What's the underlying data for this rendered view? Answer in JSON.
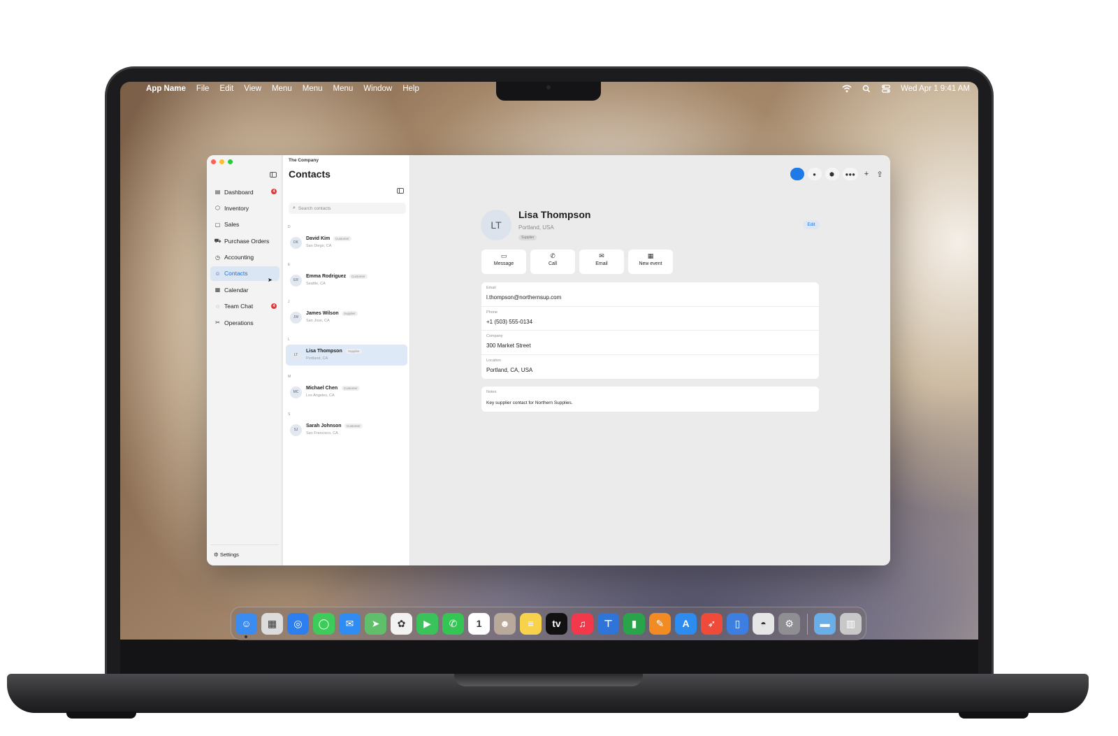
{
  "menubar": {
    "app_name": "App Name",
    "menus": [
      "File",
      "Edit",
      "View",
      "Menu",
      "Menu",
      "Menu",
      "Window",
      "Help"
    ],
    "datetime": "Wed Apr 1  9:41 AM"
  },
  "sidebar": {
    "items": [
      {
        "label": "Dashboard",
        "icon": "dashboard-icon",
        "glyph": "▤",
        "badge": "4"
      },
      {
        "label": "Inventory",
        "icon": "box-icon",
        "glyph": "⬡"
      },
      {
        "label": "Sales",
        "icon": "bag-icon",
        "glyph": "▢"
      },
      {
        "label": "Purchase Orders",
        "icon": "cart-icon",
        "glyph": "⛟"
      },
      {
        "label": "Accounting",
        "icon": "clock-icon",
        "glyph": "◷"
      },
      {
        "label": "Contacts",
        "icon": "people-icon",
        "glyph": "☺",
        "active": true
      },
      {
        "label": "Calendar",
        "icon": "calendar-icon",
        "glyph": "▦"
      },
      {
        "label": "Team Chat",
        "icon": "chat-icon",
        "glyph": "◌",
        "badge": "4"
      },
      {
        "label": "Operations",
        "icon": "tools-icon",
        "glyph": "✂"
      }
    ],
    "settings_label": "Settings"
  },
  "list": {
    "company": "The Company",
    "title": "Contacts",
    "search_placeholder": "Search contacts",
    "sections": [
      {
        "letter": "D",
        "contact": {
          "initials": "DK",
          "name": "David Kim",
          "tag": "Customer",
          "location": "San Diego, CA"
        }
      },
      {
        "letter": "E",
        "contact": {
          "initials": "ER",
          "name": "Emma Rodriguez",
          "tag": "Customer",
          "location": "Seattle, CA"
        }
      },
      {
        "letter": "J",
        "contact": {
          "initials": "JW",
          "name": "James Wilson",
          "tag": "Supplier",
          "location": "San Jose, CA"
        }
      },
      {
        "letter": "L",
        "contact": {
          "initials": "LT",
          "name": "Lisa Thompson",
          "tag": "Supplier",
          "location": "Portland, CA",
          "active": true
        }
      },
      {
        "letter": "M",
        "contact": {
          "initials": "MC",
          "name": "Michael Chen",
          "tag": "Customer",
          "location": "Los Angeles, CA"
        }
      },
      {
        "letter": "S",
        "contact": {
          "initials": "SJ",
          "name": "Sarah Johnson",
          "tag": "Customer",
          "location": "San Francisco, CA"
        }
      }
    ]
  },
  "detail": {
    "initials": "LT",
    "name": "Lisa Thompson",
    "location": "Portland, USA",
    "tag": "Supplier",
    "edit_label": "Edit",
    "actions": [
      {
        "label": "Message",
        "icon": "message-icon",
        "glyph": "▭"
      },
      {
        "label": "Call",
        "icon": "phone-icon",
        "glyph": "✆"
      },
      {
        "label": "Email",
        "icon": "mail-icon",
        "glyph": "✉"
      },
      {
        "label": "New event",
        "icon": "calendar-icon",
        "glyph": "▦"
      }
    ],
    "fields": [
      {
        "label": "Email",
        "value": "l.thompson@northernsup.com"
      },
      {
        "label": "Phone",
        "value": "+1 (503) 555-0134"
      },
      {
        "label": "Company",
        "value": "300 Market Street"
      },
      {
        "label": "Location",
        "value": "Portland, CA, USA"
      }
    ],
    "notes_label": "Notes",
    "notes_value": "Key supplier contact for Northern Supplies."
  },
  "toolbar": {
    "buttons": [
      {
        "icon": "person-icon",
        "glyph": "●"
      },
      {
        "icon": "box-icon",
        "glyph": "⬢"
      },
      {
        "icon": "group-icon",
        "glyph": "●●●"
      }
    ],
    "add_glyph": "+",
    "share_glyph": "⇪"
  },
  "dock": {
    "apps": [
      {
        "name": "finder-icon",
        "color": "#3b8cf0",
        "glyph": "☺"
      },
      {
        "name": "launchpad-icon",
        "color": "#dcdcdc",
        "glyph": "▦"
      },
      {
        "name": "safari-icon",
        "color": "#2d7ff0",
        "glyph": "◎"
      },
      {
        "name": "messages-icon",
        "color": "#3dcc59",
        "glyph": "◯"
      },
      {
        "name": "mail-icon",
        "color": "#2f8cf2",
        "glyph": "✉"
      },
      {
        "name": "maps-icon",
        "color": "#5fbf6a",
        "glyph": "➤"
      },
      {
        "name": "photos-icon",
        "color": "#f2f2f2",
        "glyph": "✿"
      },
      {
        "name": "facetime-icon",
        "color": "#3ac35a",
        "glyph": "▶"
      },
      {
        "name": "phone-icon",
        "color": "#33c653",
        "glyph": "✆"
      },
      {
        "name": "calendar-icon",
        "color": "#ffffff",
        "glyph": "1"
      },
      {
        "name": "contacts-icon",
        "color": "#b9a99a",
        "glyph": "☻"
      },
      {
        "name": "notes-icon",
        "color": "#f7d24a",
        "glyph": "≡"
      },
      {
        "name": "tv-icon",
        "color": "#111111",
        "glyph": "tv"
      },
      {
        "name": "music-icon",
        "color": "#f2384b",
        "glyph": "♫"
      },
      {
        "name": "keynote-icon",
        "color": "#2f74d8",
        "glyph": "⊤"
      },
      {
        "name": "numbers-icon",
        "color": "#2aa44a",
        "glyph": "▮"
      },
      {
        "name": "pages-icon",
        "color": "#f28b22",
        "glyph": "✎"
      },
      {
        "name": "app-store-icon",
        "color": "#2d8cf0",
        "glyph": "A"
      },
      {
        "name": "rocket-icon",
        "color": "#f04a3a",
        "glyph": "➶"
      },
      {
        "name": "simulator-icon",
        "color": "#3d7fe0",
        "glyph": "▯"
      },
      {
        "name": "disk-utility-icon",
        "color": "#e6e6e6",
        "glyph": "◓"
      },
      {
        "name": "system-settings-icon",
        "color": "#8e8e93",
        "glyph": "⚙"
      },
      {
        "name": "folder-icon",
        "color": "#6aaee8",
        "glyph": "▬"
      },
      {
        "name": "trash-icon",
        "color": "#c8c8c8",
        "glyph": "▥"
      }
    ]
  }
}
